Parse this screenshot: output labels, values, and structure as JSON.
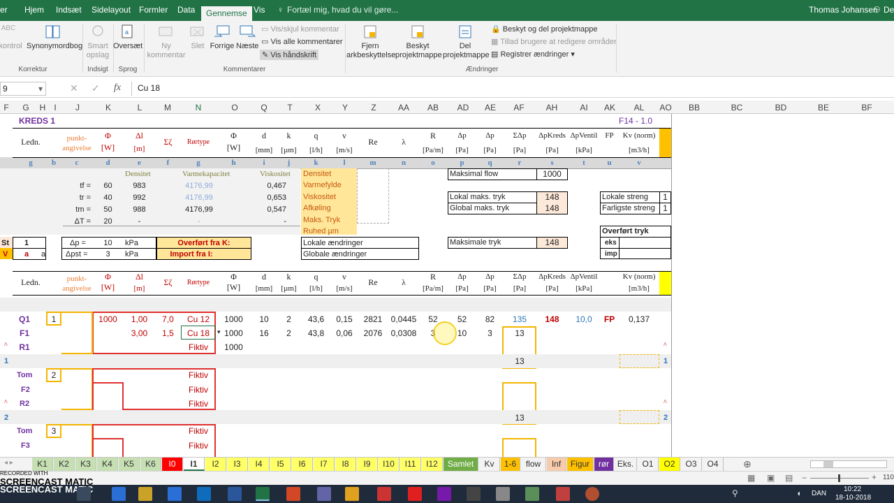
{
  "menu": {
    "tabs": [
      "er",
      "Hjem",
      "Indsæt",
      "Sidelayout",
      "Formler",
      "Data",
      "Gennemse",
      "Vis"
    ],
    "tellme": "Fortæl mig, hvad du vil gøre...",
    "user": "Thomas Johansen",
    "share": "Del"
  },
  "ribbon": {
    "buttons": [
      "ekontrol",
      "Synonymordbog",
      "Smart\nopslag",
      "Oversæt",
      "Ny\nkommentar",
      "Slet",
      "Forrige",
      "Næste",
      "Fjern\narkbeskyttelse",
      "Beskyt\nprojektmappe",
      "Del\nprojektmappe"
    ],
    "small": [
      "Vis/skjul kommentar",
      "Vis alle kommentarer",
      "Vis håndskrift",
      "Beskyt og del projektmappe",
      "Tillad brugere at redigere områder",
      "Registrer ændringer"
    ],
    "groups": [
      "Korrektur",
      "Indsigt",
      "Sprog",
      "Kommentarer",
      "Ændringer"
    ]
  },
  "formula_bar": {
    "namebox": "9",
    "fx": "fx",
    "value": "Cu 18"
  },
  "columns": [
    "F",
    "G",
    "H",
    "I",
    "J",
    "K",
    "L",
    "M",
    "N",
    "O",
    "Q",
    "T",
    "X",
    "Y",
    "Z",
    "AA",
    "AB",
    "AD",
    "AE",
    "AF",
    "AH",
    "AI",
    "AK",
    "AL",
    "AO",
    "BB",
    "BC",
    "BD",
    "BE",
    "BF"
  ],
  "sheet": {
    "title": "KREDS 1",
    "version": "F14 - 1.0",
    "hdr": {
      "ledn": "Ledn.",
      "punkt": "punkt-\nangivelse",
      "phi": "Φ",
      "W": "[W]",
      "dl": "Δl",
      "m": "[m]",
      "sz": "Σζ",
      "ror": "Rørtype",
      "di": "d",
      "mm": "[mm]",
      "k": "k",
      "um": "[µm]",
      "q": "q",
      "lh": "[l/h]",
      "v": "v",
      "ms": "[m/s]",
      "Re": "Re",
      "lam": "λ",
      "R": "R",
      "Pam": "[Pa/m]",
      "dpL": "Δp",
      "dpE": "Δp",
      "sdp": "ΣΔp",
      "Pa": "[Pa]",
      "dpk": "ΔpKreds",
      "dpv": "ΔpVentil",
      "kPa": "[kPa]",
      "FP": "FP",
      "kv": "Kv (norm)",
      "m3h": "[m3/h]"
    },
    "letters": [
      "g",
      "b",
      "c",
      "d",
      "e",
      "f",
      "g",
      "h",
      "i",
      "j",
      "k",
      "l",
      "m",
      "n",
      "o",
      "p",
      "q",
      "r",
      "s",
      "t",
      "u",
      "v"
    ],
    "props": {
      "dens": "Densitet",
      "cap": "Varmekapacitet",
      "visc": "Viskositet",
      "rows": [
        [
          "tf =",
          "60",
          "983",
          "4176,99",
          "0,467"
        ],
        [
          "tr =",
          "40",
          "992",
          "4176,99",
          "0,653"
        ],
        [
          "tm =",
          "50",
          "988",
          "4176,99",
          "0,547"
        ],
        [
          "ΔT =",
          "20",
          "-",
          "-",
          "-"
        ]
      ]
    },
    "olist": [
      "Densitet",
      "Varmefylde",
      "Viskositet",
      "Afkøling",
      "Maks. Tryk",
      "Ruhed µm"
    ],
    "local": [
      "Lokale ændringer",
      "Globale ændringer"
    ],
    "maxflow": [
      "Maksimal flow",
      "1000"
    ],
    "lokmaks": [
      "Lokal maks. tryk",
      "148"
    ],
    "globmaks": [
      "Global maks. tryk",
      "148"
    ],
    "maksim": [
      "Maksimale tryk",
      "148"
    ],
    "lokstr": [
      "Lokale streng",
      "1"
    ],
    "farl": [
      "Farligste streng",
      "1"
    ],
    "ovt": "Overført tryk",
    "eks": "eks",
    "imp": "imp",
    "st": [
      "St",
      "1",
      "V",
      "a",
      "a"
    ],
    "dp": [
      "Δp =",
      "10",
      "kPa",
      "Δpst =",
      "3",
      "kPa"
    ],
    "ovk": "Overført fra K:",
    "imi": "Import fra I:",
    "q1": [
      "Q1",
      "1",
      "1000",
      "1,00",
      "7,0",
      "Cu 12",
      "1000",
      "10",
      "2",
      "43,6",
      "0,15",
      "2821",
      "0,0445",
      "52",
      "52",
      "82",
      "135",
      "148",
      "10,0",
      "FP",
      "0,137"
    ],
    "f1": [
      "F1",
      "3,00",
      "1,5",
      "Cu 18",
      "1000",
      "16",
      "2",
      "43,8",
      "0,06",
      "2076",
      "0,0308",
      "3",
      "10",
      "3",
      "13"
    ],
    "r1": [
      "R1",
      "Fiktiv",
      "1000"
    ],
    "sum1": [
      "1",
      "13",
      "1"
    ],
    "tom2": [
      "Tom",
      "2",
      "Fiktiv"
    ],
    "f2": [
      "F2",
      "Fiktiv"
    ],
    "r2": [
      "R2",
      "Fiktiv"
    ],
    "sum2": [
      "2",
      "13",
      "2"
    ],
    "tom3": [
      "Tom",
      "3",
      "Fiktiv"
    ],
    "f3": [
      "F3",
      "Fiktiv"
    ]
  },
  "sheet_tabs": [
    "K1",
    "K2",
    "K3",
    "K4",
    "K5",
    "K6",
    "I0",
    "I1",
    "I2",
    "I3",
    "I4",
    "I5",
    "I6",
    "I7",
    "I8",
    "I9",
    "I10",
    "I11",
    "I12",
    "Samlet",
    "Kv",
    "1-6",
    "flow",
    "Inf",
    "Figur",
    "rør",
    "Eks.",
    "O1",
    "O2",
    "O3",
    "O4"
  ],
  "status": {
    "watermark": "SCREENCAST MATIC",
    "recorded": "RECORDED WITH",
    "zoom": "110",
    "lang": "DAN",
    "time": "10:22",
    "date": "18-10-2018"
  }
}
